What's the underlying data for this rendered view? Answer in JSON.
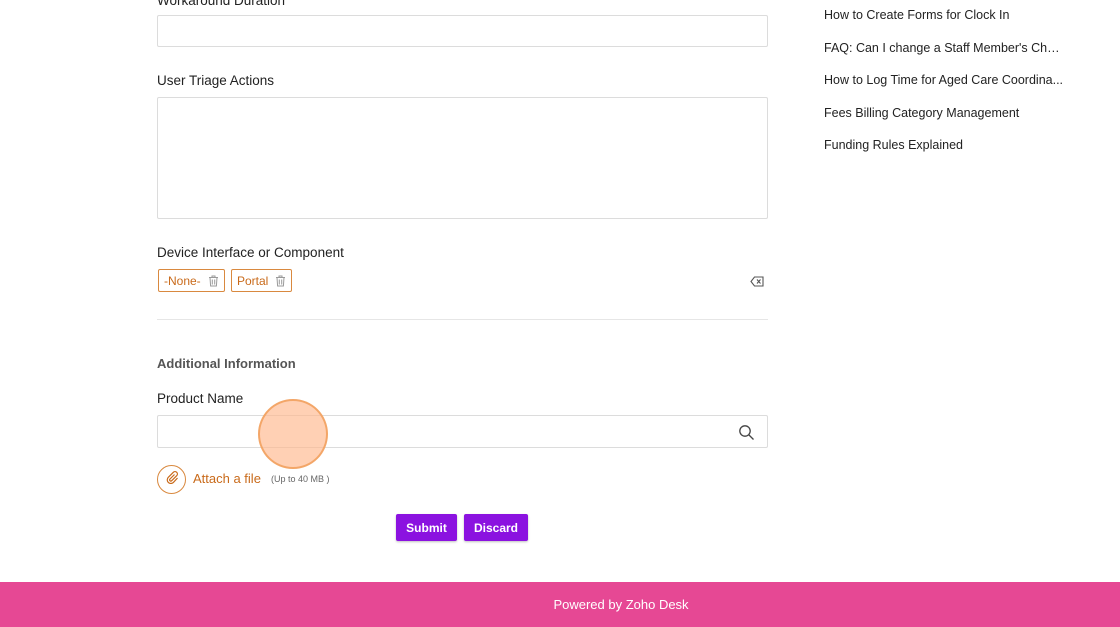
{
  "form": {
    "workaround_duration": {
      "label": "Workaround Duration",
      "value": ""
    },
    "user_triage_actions": {
      "label": "User Triage Actions",
      "value": ""
    },
    "device_interface": {
      "label": "Device Interface or Component",
      "selected": [
        "-None-",
        "Portal"
      ]
    },
    "additional_info": {
      "section_title": "Additional Information",
      "product_name": {
        "label": "Product Name",
        "value": ""
      }
    },
    "attachment": {
      "label": "Attach a file",
      "limit": "(Up to 40 MB )"
    },
    "buttons": {
      "submit": "Submit",
      "discard": "Discard"
    }
  },
  "related_articles": [
    "How to Create Forms for Clock In",
    "FAQ: Can I change a Staff Member's Che...",
    "How to Log Time for Aged Care Coordina...",
    "Fees Billing Category Management",
    "Funding Rules Explained"
  ],
  "footer": {
    "text": "Powered by Zoho Desk"
  },
  "colors": {
    "accent_orange": "#d9893f",
    "button_purple": "#8b12e0",
    "footer_pink": "#e64894"
  },
  "icons": [
    "trash-icon",
    "clear-icon",
    "search-icon",
    "paperclip-icon"
  ]
}
